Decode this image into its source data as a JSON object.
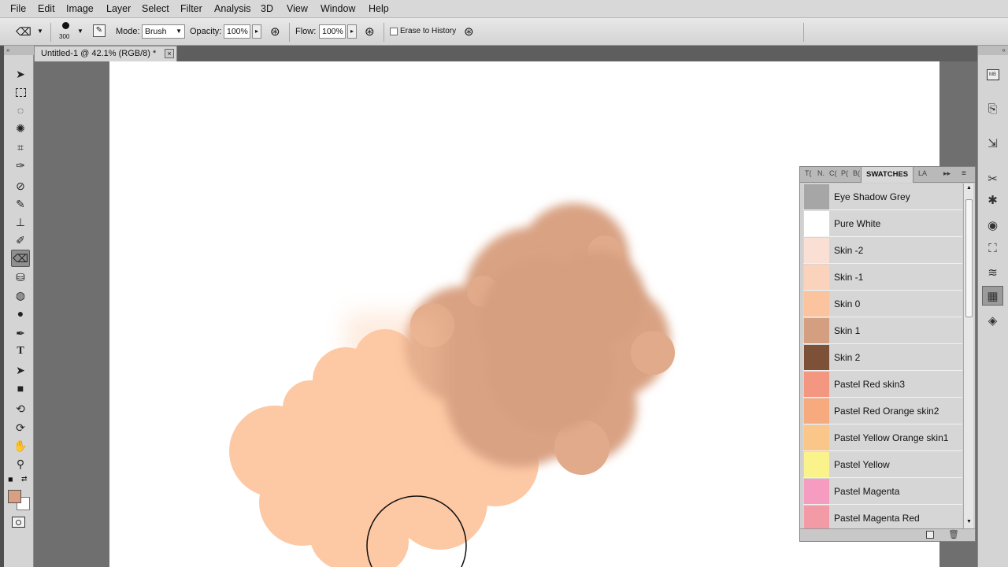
{
  "menu": [
    "File",
    "Edit",
    "Image",
    "Layer",
    "Select",
    "Filter",
    "Analysis",
    "3D",
    "View",
    "Window",
    "Help"
  ],
  "options": {
    "brush_size": "300",
    "mode_label": "Mode:",
    "mode_value": "Brush",
    "opacity_label": "Opacity:",
    "opacity_value": "100%",
    "flow_label": "Flow:",
    "flow_value": "100%",
    "erase_label": "Erase to History"
  },
  "document": {
    "tab_title": "Untitled-1 @ 42.1% (RGB/8) *",
    "close": "×"
  },
  "swatches_panel": {
    "tabs": [
      "T(",
      "N.",
      "C(",
      "P(",
      "B(",
      "SWATCHES",
      "LA"
    ],
    "active_tab": "SWATCHES",
    "items": [
      {
        "name": "Eye Shadow Grey",
        "color": "#a6a6a6"
      },
      {
        "name": "Pure White",
        "color": "#ffffff"
      },
      {
        "name": "Skin -2",
        "color": "#fae0d4"
      },
      {
        "name": "Skin -1",
        "color": "#fbd2bb"
      },
      {
        "name": "Skin 0",
        "color": "#fbc39e"
      },
      {
        "name": "Skin 1",
        "color": "#d39f80"
      },
      {
        "name": "Skin 2",
        "color": "#7d5038"
      },
      {
        "name": "Pastel Red skin3",
        "color": "#f39780"
      },
      {
        "name": "Pastel Red Orange skin2",
        "color": "#f6aa7d"
      },
      {
        "name": "Pastel Yellow Orange skin1",
        "color": "#fbc68a"
      },
      {
        "name": "Pastel Yellow",
        "color": "#faf28a"
      },
      {
        "name": "Pastel Magenta",
        "color": "#f59cc0"
      },
      {
        "name": "Pastel Magenta Red",
        "color": "#f29aa5"
      }
    ]
  },
  "colors": {
    "foreground": "#d89f80",
    "background": "#ffffff"
  }
}
